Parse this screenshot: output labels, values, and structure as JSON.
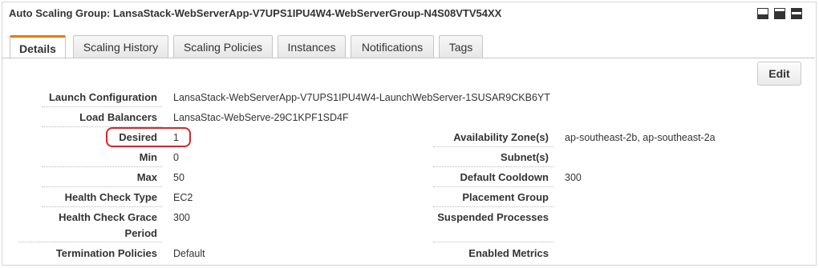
{
  "panel": {
    "title": "Auto Scaling Group: LansaStack-WebServerApp-V7UPS1IPU4W4-WebServerGroup-N4S08VTV54XX",
    "window_buttons": [
      "minimize-icon",
      "restore-icon",
      "maximize-icon"
    ]
  },
  "tabs": [
    {
      "label": "Details",
      "active": true
    },
    {
      "label": "Scaling History",
      "active": false
    },
    {
      "label": "Scaling Policies",
      "active": false
    },
    {
      "label": "Instances",
      "active": false
    },
    {
      "label": "Notifications",
      "active": false
    },
    {
      "label": "Tags",
      "active": false
    }
  ],
  "edit_label": "Edit",
  "details_left": [
    {
      "label": "Launch Configuration",
      "value": "LansaStack-WebServerApp-V7UPS1IPU4W4-LaunchWebServer-1SUSAR9CKB6YT"
    },
    {
      "label": "Load Balancers",
      "value": "LansaStac-WebServe-29C1KPF1SD4F"
    },
    {
      "label": "Desired",
      "value": "1"
    },
    {
      "label": "Min",
      "value": "0"
    },
    {
      "label": "Max",
      "value": "50"
    },
    {
      "label": "Health Check Type",
      "value": "EC2"
    },
    {
      "label": "Health Check Grace",
      "label2": "Period",
      "value": "300"
    },
    {
      "label": "Termination Policies",
      "value": "Default"
    }
  ],
  "details_right": [
    {
      "label": "Availability Zone(s)",
      "value": "ap-southeast-2b, ap-southeast-2a"
    },
    {
      "label": "Subnet(s)",
      "value": ""
    },
    {
      "label": "Default Cooldown",
      "value": "300"
    },
    {
      "label": "Placement Group",
      "value": ""
    },
    {
      "label": "Suspended Processes",
      "value": ""
    },
    {
      "label": "Enabled Metrics",
      "value": ""
    }
  ],
  "highlight_color": "#d9252a",
  "active_tab_accent": "#e47911"
}
